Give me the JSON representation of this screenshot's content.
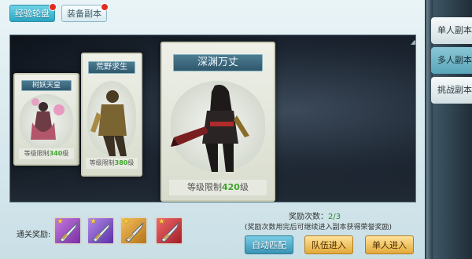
{
  "top_tabs": [
    {
      "label": "经验轮盘",
      "active": true,
      "badge": true
    },
    {
      "label": "装备副本",
      "active": false,
      "badge": true
    }
  ],
  "side_tabs": [
    {
      "label": "单人副本",
      "active": false
    },
    {
      "label": "多人副本",
      "active": true
    },
    {
      "label": "挑战副本",
      "active": false
    }
  ],
  "cards": [
    {
      "name": "树妖天皇",
      "level_prefix": "等级限制",
      "level": "340",
      "level_suffix": "级"
    },
    {
      "name": "荒野求生",
      "level_prefix": "等级限制",
      "level": "380",
      "level_suffix": "级"
    },
    {
      "name": "深渊万丈",
      "level_prefix": "等级限制",
      "level": "420",
      "level_suffix": "级"
    }
  ],
  "rewards": {
    "label": "通关奖励:",
    "items": [
      {
        "icon": "sword-icon",
        "color": "#a24cc7"
      },
      {
        "icon": "sword-icon",
        "color": "#8e57d2"
      },
      {
        "icon": "sword-icon",
        "color": "#e0a13a"
      },
      {
        "icon": "sword-icon",
        "color": "#d9464a"
      }
    ]
  },
  "reward_count": {
    "label": "奖励次数：",
    "value": "2/3"
  },
  "hint": "(奖励次数用完后可继续进入副本获得荣誉奖励)",
  "buttons": {
    "auto_match": "自动匹配",
    "team_enter": "队伍进入",
    "solo_enter": "单人进入"
  }
}
